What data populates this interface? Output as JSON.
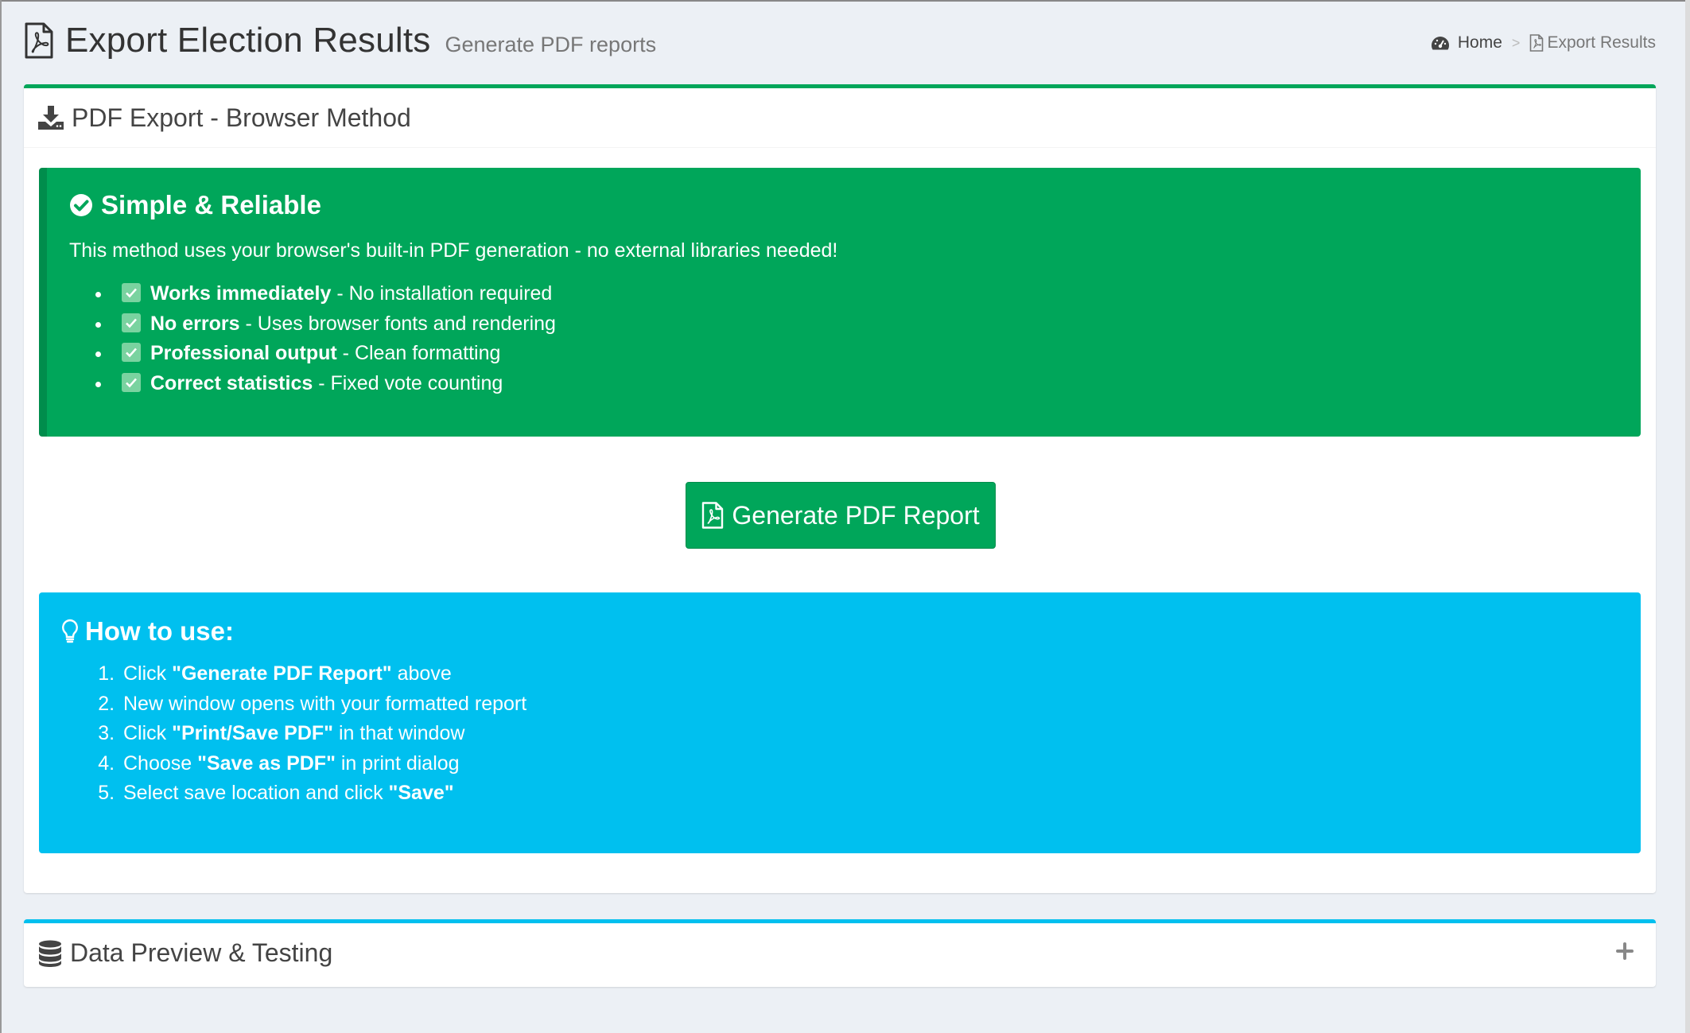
{
  "header": {
    "title": "Export Election Results",
    "subtitle": "Generate PDF reports",
    "title_icon": "file-pdf-icon"
  },
  "breadcrumb": {
    "home_label": "Home",
    "home_icon": "dashboard-icon",
    "current_label": "Export Results",
    "current_icon": "file-pdf-icon",
    "separator": ">"
  },
  "main_box": {
    "title": "PDF Export - Browser Method",
    "icon": "download-icon",
    "accent_color": "#00a65a"
  },
  "success_callout": {
    "title": "Simple & Reliable",
    "icon": "check-circle-icon",
    "intro": "This method uses your browser's built-in PDF generation - no external libraries needed!",
    "color": "#00a65a",
    "features": [
      {
        "bold": "Works immediately",
        "text": " - No installation required"
      },
      {
        "bold": "No errors",
        "text": " - Uses browser fonts and rendering"
      },
      {
        "bold": "Professional output",
        "text": " - Clean formatting"
      },
      {
        "bold": "Correct statistics",
        "text": " - Fixed vote counting"
      }
    ]
  },
  "generate_button": {
    "label": "Generate PDF Report",
    "icon": "file-pdf-icon"
  },
  "info_callout": {
    "title": "How to use:",
    "icon": "lightbulb-icon",
    "color": "#00c0ef",
    "steps": [
      {
        "pre": "Click ",
        "bold": "\"Generate PDF Report\"",
        "post": " above"
      },
      {
        "pre": "New window opens with your formatted report",
        "bold": "",
        "post": ""
      },
      {
        "pre": "Click ",
        "bold": "\"Print/Save PDF\"",
        "post": " in that window"
      },
      {
        "pre": "Choose ",
        "bold": "\"Save as PDF\"",
        "post": " in print dialog"
      },
      {
        "pre": "Select save location and click ",
        "bold": "\"Save\"",
        "post": ""
      }
    ]
  },
  "preview_box": {
    "title": "Data Preview & Testing",
    "icon": "database-icon",
    "tool_icon": "plus-icon",
    "accent_color": "#00c0ef"
  }
}
